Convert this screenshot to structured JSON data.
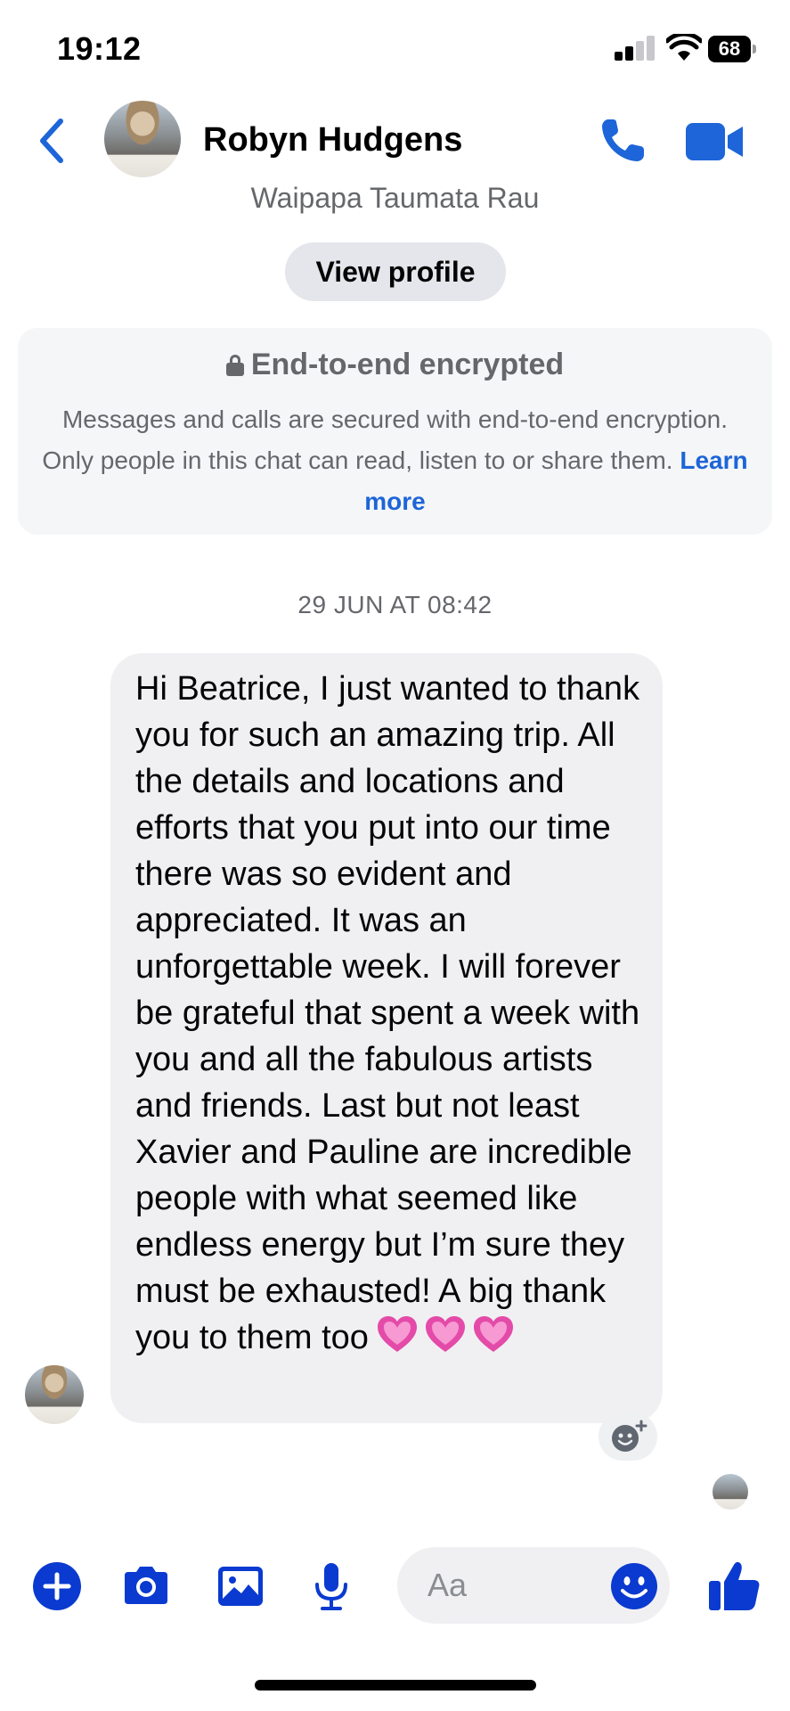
{
  "status_bar": {
    "time": "19:12",
    "battery": "68"
  },
  "header": {
    "contact_name": "Robyn Hudgens",
    "subtitle": "Waipapa Taumata Rau",
    "view_profile_label": "View profile"
  },
  "encryption": {
    "title": "End-to-end encrypted",
    "body": "Messages and calls are secured with end-to-end encryption. Only people in this chat can read, listen to or share them.",
    "link_label": "Learn more"
  },
  "conversation": {
    "timestamp": "29 JUN AT 08:42",
    "messages": [
      {
        "sender": "Robyn Hudgens",
        "text": "Hi Beatrice, I just wanted to thank you for such an amazing trip. All the details and locations and efforts that you put into our time there was so evident and appreciated. It was an unforgettable week. I will forever be grateful that spent a week with you and all the fabulous artists and friends. Last but not least Xavier and Pauline are incredible people with what seemed like endless energy but I’m sure they must be exhausted! A big thank you to them too",
        "emoji": [
          "pink-heart",
          "pink-heart",
          "pink-heart"
        ]
      }
    ]
  },
  "composer": {
    "placeholder": "Aa"
  },
  "colors": {
    "accent": "#0a3ad0",
    "header_blue": "#1d65d8",
    "bubble": "#f0f0f3",
    "secondary_text": "#65676b"
  },
  "icons": [
    "back-chevron-icon",
    "phone-icon",
    "video-camera-icon",
    "lock-icon",
    "add-icon",
    "camera-icon",
    "gallery-icon",
    "microphone-icon",
    "emoji-icon",
    "thumbs-up-icon",
    "add-reaction-icon"
  ]
}
